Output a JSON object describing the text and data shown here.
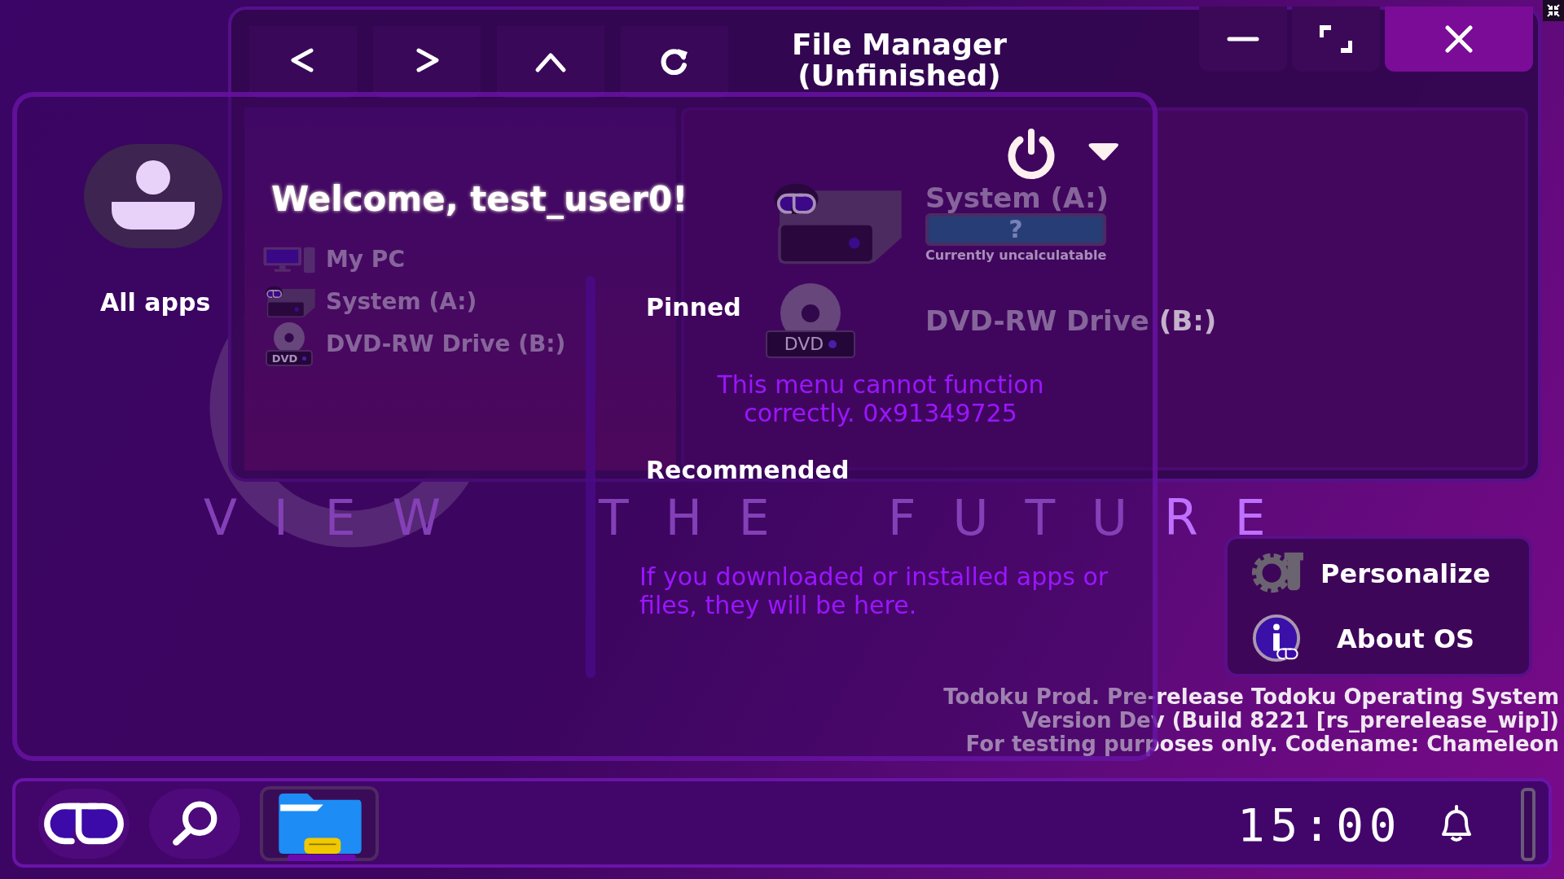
{
  "wallpaper": {
    "tagline": [
      "VIEW",
      "THE",
      "FUTURE"
    ]
  },
  "version_info": [
    "Todoku Prod. Pre-release Todoku Operating System",
    "Version Dev (Build 8221 [rs_prerelease_wip])",
    "For testing purposes only. Codename: Chameleon"
  ],
  "file_manager": {
    "title": [
      "File Manager",
      "(Unfinished)"
    ],
    "nav_buttons": [
      {
        "kind": "back"
      },
      {
        "kind": "forward"
      },
      {
        "kind": "up"
      },
      {
        "kind": "refresh"
      }
    ],
    "window_controls": [
      {
        "kind": "minimize"
      },
      {
        "kind": "maximize"
      },
      {
        "kind": "close"
      }
    ],
    "sidebar": [
      {
        "kind": "pc",
        "label": "My PC"
      },
      {
        "kind": "system",
        "label": "System (A:)"
      },
      {
        "kind": "dvd",
        "label": "DVD-RW Drive (B:)",
        "icon_label": "DVD"
      }
    ],
    "drives": [
      {
        "kind": "system",
        "label": "System (A:)",
        "usage": "?",
        "note": "Currently uncalculatable"
      },
      {
        "kind": "dvd",
        "label": "DVD-RW Drive (B:)",
        "icon_label": "DVD"
      }
    ]
  },
  "start_menu": {
    "welcome": "Welcome, test_user0!",
    "all_apps": "All apps",
    "pinned": "Pinned",
    "pinned_message": "This menu cannot function correctly. 0x91349725",
    "recommended": "Recommended",
    "recommended_message": "If you downloaded or installed apps or files, they will be here."
  },
  "quick_panel": [
    {
      "kind": "personalize",
      "label": "Personalize"
    },
    {
      "kind": "about",
      "label": "About OS"
    }
  ],
  "taskbar": {
    "apps": [
      {
        "kind": "logo",
        "selected": false
      },
      {
        "kind": "search",
        "selected": false
      },
      {
        "kind": "files",
        "selected": true
      }
    ],
    "clock": "15:00"
  }
}
